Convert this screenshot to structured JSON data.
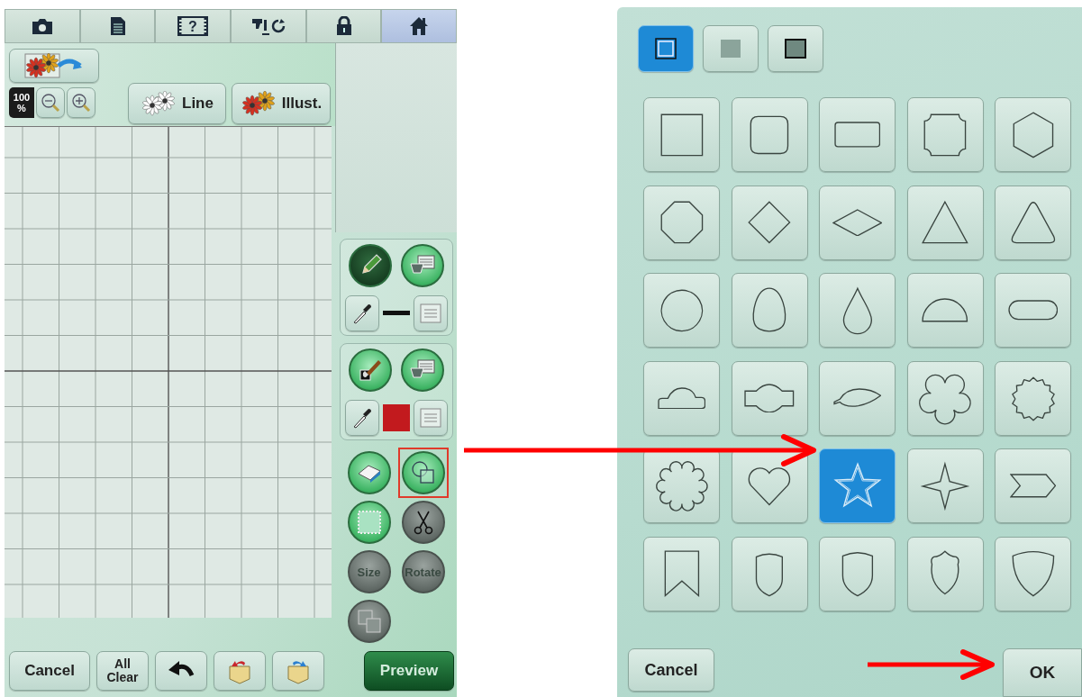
{
  "left_screen": {
    "top_tabs": [
      {
        "kind": "camera",
        "selected": false
      },
      {
        "kind": "document",
        "selected": false
      },
      {
        "kind": "help",
        "label": "?",
        "selected": false
      },
      {
        "kind": "machine",
        "selected": false
      },
      {
        "kind": "lock",
        "selected": false
      },
      {
        "kind": "home",
        "selected": true
      }
    ],
    "zoom_level": "100 %",
    "stamp_buttons": [
      {
        "kind": "line",
        "label": "Line"
      },
      {
        "kind": "illust",
        "label": "Illust."
      }
    ],
    "tool_panels": [
      {
        "tools": [
          {
            "kind": "pencil",
            "selected": true
          },
          {
            "kind": "bucket",
            "selected": false
          }
        ],
        "kind": "line",
        "color": "#111111"
      },
      {
        "tools": [
          {
            "kind": "brush",
            "selected": false
          },
          {
            "kind": "bucket",
            "selected": false
          }
        ],
        "kind": "fill",
        "color": "#c21a1e"
      }
    ],
    "edit_tools": [
      {
        "kind": "eraser",
        "disabled": false,
        "highlighted": false
      },
      {
        "kind": "shape",
        "disabled": false,
        "highlighted": true
      },
      {
        "kind": "select",
        "disabled": false,
        "highlighted": false
      },
      {
        "kind": "scissors",
        "disabled": true,
        "highlighted": false
      },
      {
        "kind": "text",
        "label": "Size",
        "disabled": true,
        "highlighted": false
      },
      {
        "kind": "text",
        "label": "Rotate",
        "disabled": true,
        "highlighted": false
      },
      {
        "kind": "layers",
        "disabled": true,
        "highlighted": false
      }
    ],
    "bottom_buttons": [
      {
        "kind": "text",
        "label": "Cancel"
      },
      {
        "kind": "text",
        "label": "All Clear"
      },
      {
        "kind": "undo"
      },
      {
        "kind": "pocket-in"
      },
      {
        "kind": "pocket-out"
      },
      {
        "kind": "primary",
        "label": "Preview"
      }
    ]
  },
  "right_screen": {
    "modes": [
      {
        "kind": "outline",
        "selected": true
      },
      {
        "kind": "fill",
        "selected": false
      },
      {
        "kind": "outline-fill",
        "selected": false
      }
    ],
    "shapes": [
      {
        "kind": "square",
        "selected": false
      },
      {
        "kind": "rounded-square",
        "selected": false
      },
      {
        "kind": "rounded-rect",
        "selected": false
      },
      {
        "kind": "notched-square",
        "selected": false
      },
      {
        "kind": "hexagon",
        "selected": false
      },
      {
        "kind": "octagon",
        "selected": false
      },
      {
        "kind": "diamond",
        "selected": false
      },
      {
        "kind": "flat-diamond",
        "selected": false
      },
      {
        "kind": "triangle",
        "selected": false
      },
      {
        "kind": "rounded-triangle",
        "selected": false
      },
      {
        "kind": "circle",
        "selected": false
      },
      {
        "kind": "egg",
        "selected": false
      },
      {
        "kind": "drop",
        "selected": false
      },
      {
        "kind": "half-circle",
        "selected": false
      },
      {
        "kind": "capsule",
        "selected": false
      },
      {
        "kind": "cloud",
        "selected": false
      },
      {
        "kind": "label",
        "selected": false
      },
      {
        "kind": "leaf",
        "selected": false
      },
      {
        "kind": "flower",
        "selected": false
      },
      {
        "kind": "seal",
        "selected": false
      },
      {
        "kind": "scallop",
        "selected": false
      },
      {
        "kind": "heart",
        "selected": false
      },
      {
        "kind": "star",
        "selected": true
      },
      {
        "kind": "sparkle",
        "selected": false
      },
      {
        "kind": "chevron",
        "selected": false
      },
      {
        "kind": "bookmark",
        "selected": false
      },
      {
        "kind": "shield-narrow",
        "selected": false
      },
      {
        "kind": "shield",
        "selected": false
      },
      {
        "kind": "shield-crest",
        "selected": false
      },
      {
        "kind": "shield-wide",
        "selected": false
      }
    ],
    "buttons": [
      {
        "kind": "cancel",
        "label": "Cancel"
      },
      {
        "kind": "ok",
        "label": "OK"
      }
    ]
  }
}
